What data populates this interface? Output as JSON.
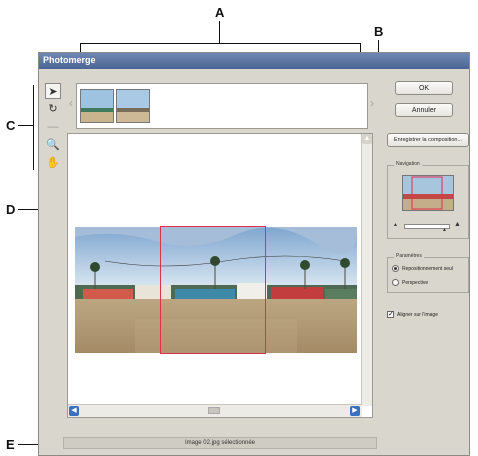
{
  "callouts": {
    "a": "A",
    "b": "B",
    "c": "C",
    "d": "D",
    "e": "E"
  },
  "window": {
    "title": "Photomerge"
  },
  "tools": [
    "select-image-tool",
    "rotate-image-tool",
    "zoom-tool",
    "move-view-tool"
  ],
  "buttons": {
    "ok": "OK",
    "cancel": "Annuler",
    "save_composition": "Enregistrer la composition..."
  },
  "navigator": {
    "label": "Navigation"
  },
  "settings": {
    "label": "Paramètres",
    "options": [
      "Repositionnement seul",
      "Perspective"
    ],
    "selected": "Repositionnement seul"
  },
  "snap": {
    "label": "Aligner sur l'image",
    "checked": true
  },
  "status": {
    "text": "Image 02.jpg sélectionnée"
  }
}
